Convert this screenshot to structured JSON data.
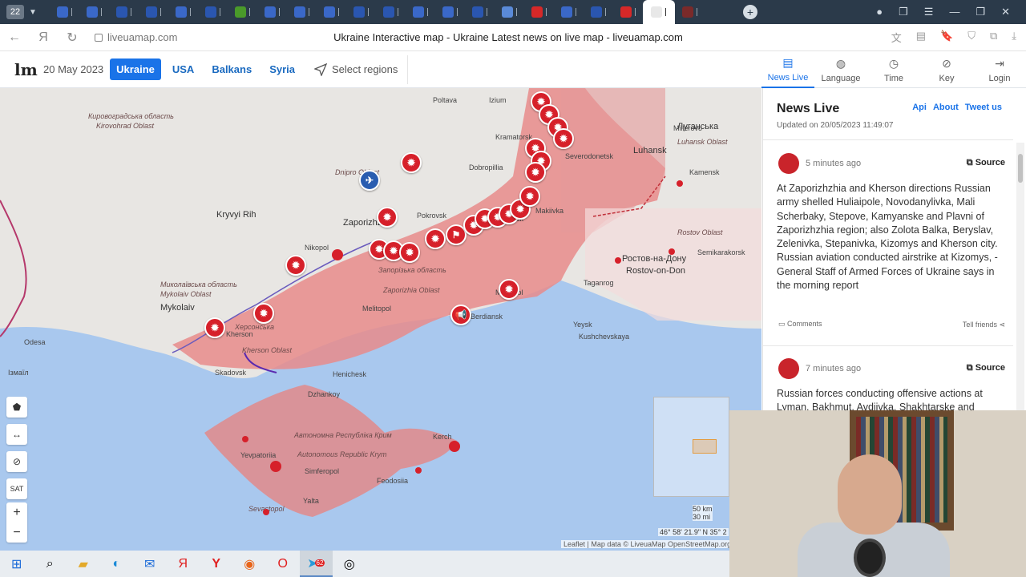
{
  "browser": {
    "tab_count": "22",
    "page_title": "Ukraine Interactive map - Ukraine Latest news on live map - liveuamap.com",
    "url": "liveuamap.com",
    "tab_icon_colors": [
      "#3a68c8",
      "#3a68c8",
      "#2a56b0",
      "#2a56b0",
      "#3a68c8",
      "#2a56b0",
      "#4a9a2a",
      "#3a68c8",
      "#3a68c8",
      "#3a68c8",
      "#2a56b0",
      "#2a56b0",
      "#3a68c8",
      "#3a68c8",
      "#2a56b0",
      "#5a8ad8",
      "#d62828",
      "#3a68c8",
      "#2a56b0",
      "#d62828",
      "#e8e8e8",
      "#7a2a2a"
    ]
  },
  "site": {
    "logo": "lm",
    "date": "20 May 2023",
    "regions": [
      "Ukraine",
      "USA",
      "Balkans",
      "Syria"
    ],
    "select_regions": "Select regions",
    "tabs": [
      "News Live",
      "Language",
      "Time",
      "Key",
      "Login"
    ]
  },
  "map": {
    "places": [
      {
        "t": "Луганська",
        "c": "big"
      },
      {
        "t": "Luhansk Oblast",
        "c": "ital"
      },
      {
        "t": "Luhansk",
        "c": "big"
      },
      {
        "t": "Kramatorsk",
        "c": ""
      },
      {
        "t": "Severodonetsk",
        "c": ""
      },
      {
        "t": "Dobropillia",
        "c": ""
      },
      {
        "t": "Pokrovsk",
        "c": ""
      },
      {
        "t": "Donetsk",
        "c": ""
      },
      {
        "t": "Makiivka",
        "c": ""
      },
      {
        "t": "Zaporizhzhia",
        "c": "big"
      },
      {
        "t": "Запорізька область",
        "c": "ital"
      },
      {
        "t": "Zaporizhia Oblast",
        "c": "ital"
      },
      {
        "t": "Kryvyi Rih",
        "c": "big"
      },
      {
        "t": "Nikopol",
        "c": ""
      },
      {
        "t": "Mykolaiv",
        "c": "big"
      },
      {
        "t": "Kherson",
        "c": ""
      },
      {
        "t": "Херсонська",
        "c": "ital"
      },
      {
        "t": "Kherson Oblast",
        "c": "ital"
      },
      {
        "t": "Melitopol",
        "c": ""
      },
      {
        "t": "Berdiansk",
        "c": ""
      },
      {
        "t": "Mariupol",
        "c": ""
      },
      {
        "t": "Henichesk",
        "c": ""
      },
      {
        "t": "Skadovsk",
        "c": ""
      },
      {
        "t": "Dzhankoy",
        "c": ""
      },
      {
        "t": "Автономна Республіка Крим",
        "c": "ital"
      },
      {
        "t": "Autonomous Republic Krym",
        "c": "ital"
      },
      {
        "t": "Yevpatoriia",
        "c": ""
      },
      {
        "t": "Simferopol",
        "c": ""
      },
      {
        "t": "Sevastopol",
        "c": "ital"
      },
      {
        "t": "Yalta",
        "c": ""
      },
      {
        "t": "Feodosiia",
        "c": ""
      },
      {
        "t": "Kerch",
        "c": ""
      },
      {
        "t": "Ростов-на-Дону",
        "c": "big"
      },
      {
        "t": "Rostov-on-Don",
        "c": "big"
      },
      {
        "t": "Taganrog",
        "c": ""
      },
      {
        "t": "Odesa",
        "c": ""
      },
      {
        "t": "Ізмаїл",
        "c": ""
      },
      {
        "t": "Dnipro Oblast",
        "c": "ital"
      },
      {
        "t": "Кировоградська область",
        "c": "ital"
      },
      {
        "t": "Kirovohrad Oblast",
        "c": "ital"
      },
      {
        "t": "Миколаївська область",
        "c": "ital"
      },
      {
        "t": "Mykolaiv Oblast",
        "c": "ital"
      },
      {
        "t": "Millerovo",
        "c": ""
      },
      {
        "t": "Kamensk",
        "c": ""
      },
      {
        "t": "Semikarakorsk",
        "c": ""
      },
      {
        "t": "Yeysk",
        "c": ""
      },
      {
        "t": "Kushchevskaya",
        "c": ""
      },
      {
        "t": "Rostov Oblast",
        "c": "ital"
      },
      {
        "t": "Poltava",
        "c": ""
      },
      {
        "t": "Izium",
        "c": ""
      }
    ],
    "markers": [
      "explosion-icon",
      "explosion-icon",
      "explosion-icon",
      "explosion-icon",
      "explosion-icon",
      "explosion-icon",
      "explosion-icon",
      "explosion-icon",
      "aircraft-icon",
      "explosion-icon",
      "explosion-icon",
      "explosion-icon",
      "explosion-icon",
      "explosion-icon",
      "artillery-icon",
      "explosion-icon",
      "explosion-icon",
      "explosion-icon",
      "explosion-icon",
      "explosion-icon",
      "explosion-icon",
      "explosion-icon",
      "explosion-icon",
      "megaphone-icon",
      "explosion-icon",
      "explosion-icon"
    ],
    "controls": {
      "zoom_in": "+",
      "zoom_out": "−",
      "sat": "SAT"
    },
    "scale": {
      "km": "50 km",
      "mi": "30 mi"
    },
    "coords": "46° 58' 21.9\" N 35° 2",
    "attribution": "Leaflet | Map data © LiveuaMap OpenStreetMap.org"
  },
  "news": {
    "title": "News Live",
    "links": [
      "Api",
      "About",
      "Tweet us"
    ],
    "updated": "Updated on 20/05/2023 11:49:07",
    "items": [
      {
        "time": "5 minutes ago",
        "source": "Source",
        "text": "At Zaporizhzhia and Kherson directions Russian army shelled Huliaipole, Novodanylivka, Mali Scherbaky, Stepove, Kamyanske and Plavni of Zaporizhzhia region; also Zolota Balka, Beryslav, Zelenivka, Stepanivka, Kizomys and Kherson city. Russian aviation conducted airstrike at Kizomys, - General Staff of Armed Forces of Ukraine says in the morning report",
        "comments": "Comments",
        "tell": "Tell friends"
      },
      {
        "time": "7 minutes ago",
        "source": "Source",
        "text": "Russian forces conducting offensive actions at Lyman, Bakhmut, Avdiivka, Shakhtarske and Marinka directions"
      }
    ]
  },
  "taskbar": {
    "icons": [
      "windows-start-icon",
      "search-icon",
      "file-explorer-icon",
      "edge-icon",
      "mail-icon",
      "yandex-icon",
      "yandex-browser-icon",
      "firefox-icon",
      "opera-icon",
      "telegram-icon",
      "obs-icon"
    ],
    "telegram_badge": "62"
  }
}
